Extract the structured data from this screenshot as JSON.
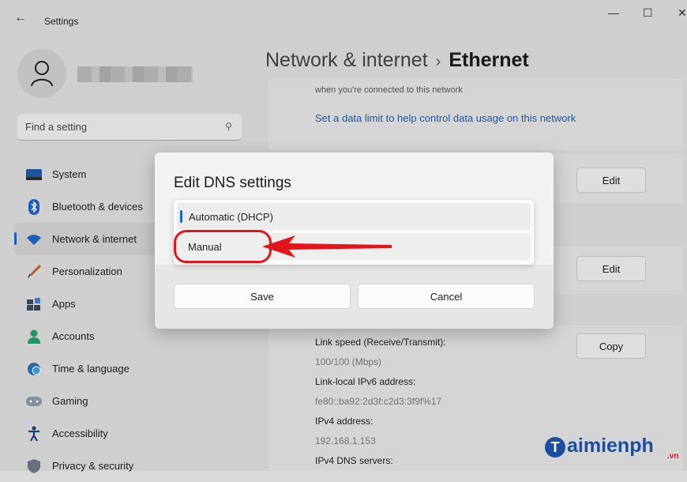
{
  "window": {
    "title": "Settings",
    "back_icon": "back-arrow-icon",
    "controls": [
      "—",
      "☐",
      "✕"
    ]
  },
  "sidebar": {
    "search_placeholder": "Find a setting",
    "items": [
      {
        "label": "System",
        "icon": "monitor-icon"
      },
      {
        "label": "Bluetooth & devices",
        "icon": "bluetooth-icon"
      },
      {
        "label": "Network & internet",
        "icon": "wifi-icon",
        "active": true
      },
      {
        "label": "Personalization",
        "icon": "brush-icon"
      },
      {
        "label": "Apps",
        "icon": "apps-icon"
      },
      {
        "label": "Accounts",
        "icon": "person-icon"
      },
      {
        "label": "Time & language",
        "icon": "globe-clock-icon"
      },
      {
        "label": "Gaming",
        "icon": "gamepad-icon"
      },
      {
        "label": "Accessibility",
        "icon": "accessibility-icon"
      },
      {
        "label": "Privacy & security",
        "icon": "shield-icon"
      }
    ]
  },
  "header": {
    "crumb": "Network & internet",
    "separator": "›",
    "current": "Ethernet"
  },
  "main": {
    "metered_note": "when you're connected to this network",
    "data_limit_link": "Set a data limit to help control data usage on this network",
    "edit_label_1": "Edit",
    "edit_label_2": "Edit",
    "copy_label": "Copy",
    "properties": [
      {
        "label": "Link speed (Receive/Transmit):",
        "value": "100/100 (Mbps)"
      },
      {
        "label": "Link-local IPv6 address:",
        "value": "fe80::ba92:2d3f:c2d3:3f9f%17"
      },
      {
        "label": "IPv4 address:",
        "value": "192.168.1.153"
      },
      {
        "label": "IPv4 DNS servers:",
        "value": ""
      }
    ]
  },
  "dialog": {
    "title": "Edit DNS settings",
    "options": [
      "Automatic (DHCP)",
      "Manual"
    ],
    "selected": "Automatic (DHCP)",
    "save_label": "Save",
    "cancel_label": "Cancel"
  },
  "watermark": {
    "initial": "T",
    "text": "aimienph",
    "suffix": ".vn"
  },
  "colors": {
    "accent": "#1a66c2",
    "highlight": "#e3141b",
    "link": "#1b5fb0"
  }
}
